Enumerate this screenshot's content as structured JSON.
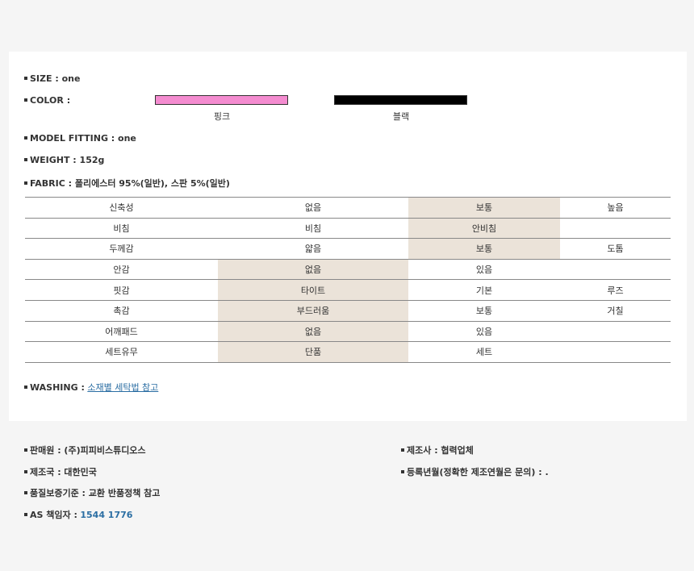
{
  "size": {
    "label": "SIZE : one"
  },
  "color": {
    "label": "COLOR :",
    "swatches": [
      {
        "name": "핑크",
        "hex": "#f48cd0"
      },
      {
        "name": "블랙",
        "hex": "#000000"
      }
    ]
  },
  "model_fitting": {
    "label": "MODEL FITTING : one"
  },
  "weight": {
    "label": "WEIGHT : 152g"
  },
  "fabric": {
    "label": "FABRIC : 폴리에스터 95%(일반), 스판 5%(일반)"
  },
  "spec_table": {
    "rows": [
      {
        "name": "신축성",
        "cells": [
          "없음",
          "보통",
          "높음"
        ],
        "selected": 1
      },
      {
        "name": "비침",
        "cells": [
          "비침",
          "안비침",
          ""
        ],
        "selected": 1
      },
      {
        "name": "두께감",
        "cells": [
          "얇음",
          "보통",
          "도톰"
        ],
        "selected": 1
      },
      {
        "name": "안감",
        "cells": [
          "없음",
          "있음",
          ""
        ],
        "selected": 0
      },
      {
        "name": "핏감",
        "cells": [
          "타이트",
          "기본",
          "루즈"
        ],
        "selected": 0
      },
      {
        "name": "촉감",
        "cells": [
          "부드러움",
          "보통",
          "거칠"
        ],
        "selected": 0
      },
      {
        "name": "어깨패드",
        "cells": [
          "없음",
          "있음",
          ""
        ],
        "selected": 0
      },
      {
        "name": "세트유무",
        "cells": [
          "단품",
          "세트",
          ""
        ],
        "selected": 0
      }
    ],
    "highlight_color": "#ebe3d9"
  },
  "washing": {
    "label": "WASHING :",
    "link_text": "소재별 세탁법 참고"
  },
  "footer": {
    "seller": "판매원 : (주)피피비스튜디오스",
    "country": "제조국 : 대한민국",
    "quality": "품질보증기준 : 교환 반품정책 참고",
    "as_label": "AS 책임자 :",
    "as_phone": "1544 1776",
    "maker": "제조사 : 협력업체",
    "reg_date": "등록년월(정확한 제조연월은 문의) : ."
  }
}
